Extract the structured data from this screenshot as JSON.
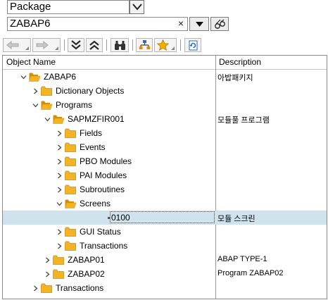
{
  "selector": {
    "type_value": "Package",
    "object_value": "ZABAP6",
    "clear_symbol": "×"
  },
  "columns": {
    "name": "Object Name",
    "description": "Description"
  },
  "tree": [
    {
      "label": "ZABAP6",
      "desc": "아밥패키지",
      "level": 0,
      "state": "open"
    },
    {
      "label": "Dictionary Objects",
      "desc": "",
      "level": 1,
      "state": "closed"
    },
    {
      "label": "Programs",
      "desc": "",
      "level": 1,
      "state": "open"
    },
    {
      "label": "SAPMZFIR001",
      "desc": "모듈풀 프로그램",
      "level": 2,
      "state": "open"
    },
    {
      "label": "Fields",
      "desc": "",
      "level": 3,
      "state": "closed"
    },
    {
      "label": "Events",
      "desc": "",
      "level": 3,
      "state": "closed"
    },
    {
      "label": "PBO Modules",
      "desc": "",
      "level": 3,
      "state": "closed"
    },
    {
      "label": "PAI Modules",
      "desc": "",
      "level": 3,
      "state": "closed"
    },
    {
      "label": "Subroutines",
      "desc": "",
      "level": 3,
      "state": "closed"
    },
    {
      "label": "Screens",
      "desc": "",
      "level": 3,
      "state": "open"
    },
    {
      "label": "0100",
      "desc": "모듈 스크린",
      "level": 4,
      "state": "leaf"
    },
    {
      "label": "GUI Status",
      "desc": "",
      "level": 3,
      "state": "closed"
    },
    {
      "label": "Transactions",
      "desc": "",
      "level": 3,
      "state": "closed"
    },
    {
      "label": "ZABAP01",
      "desc": "ABAP TYPE-1",
      "level": 2,
      "state": "closed"
    },
    {
      "label": "ZABAP02",
      "desc": "Program ZABAP02",
      "level": 2,
      "state": "closed"
    },
    {
      "label": "Transactions",
      "desc": "",
      "level": 1,
      "state": "closed"
    }
  ],
  "selected_row": 10,
  "colors": {
    "folder": "#f2b325",
    "folder_dark": "#d08e0f",
    "selection": "#cfe3ef",
    "accent_blue": "#2a6db5"
  }
}
